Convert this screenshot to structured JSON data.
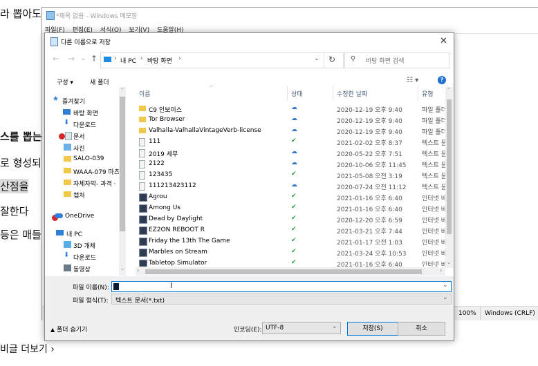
{
  "background_page": {
    "lines": [
      "라 뽑아도",
      "스를 뽑는",
      "로 형성되",
      "산점을",
      "잘한다",
      "등은 매들",
      "비글 더보기 ›"
    ]
  },
  "notepad": {
    "title": "*제목 없음 - Windows 메모장",
    "menu": [
      "파일(F)",
      "편집(E)",
      "서식(O)",
      "보기(V)",
      "도움말(H)"
    ],
    "status": {
      "zoom": "100%",
      "line_ending": "Windows (CRLF)"
    }
  },
  "dialog": {
    "title": "다른 이름으로 저장",
    "close": "✕",
    "breadcrumb": [
      "내 PC",
      "바탕 화면"
    ],
    "search_placeholder": "바탕 화면 검색",
    "cmd": {
      "organize": "구성 ▾",
      "new_folder": "새 폴더"
    },
    "tree": [
      {
        "label": "즐겨찾기",
        "icon": "star-icon",
        "pin": false
      },
      {
        "label": "바탕 화면",
        "icon": "desktop-icon",
        "pin": true
      },
      {
        "label": "다운로드",
        "icon": "download-icon",
        "pin": true
      },
      {
        "label": "문서",
        "icon": "document-icon",
        "pin": true
      },
      {
        "label": "사진",
        "icon": "pictures-icon",
        "pin": true
      },
      {
        "label": "SALO-039",
        "icon": "folder-icon",
        "pin": false
      },
      {
        "label": "WAAA-079 마츠",
        "icon": "folder-icon",
        "pin": false
      },
      {
        "label": "자체자막- 과격 ·",
        "icon": "folder-icon",
        "pin": false
      },
      {
        "label": "캡처",
        "icon": "folder-icon",
        "pin": false
      },
      {
        "label": "OneDrive",
        "icon": "cloud-icon",
        "pin": false
      },
      {
        "label": "내 PC",
        "icon": "pc-icon",
        "pin": false
      },
      {
        "label": "3D 개체",
        "icon": "cube-icon",
        "pin": false
      },
      {
        "label": "다운로드",
        "icon": "download-icon",
        "pin": false
      },
      {
        "label": "동영상",
        "icon": "video-icon",
        "pin": false
      }
    ],
    "columns": {
      "name": "이름",
      "status": "상태",
      "modified": "수정한 날짜",
      "type": "유형"
    },
    "files": [
      {
        "name": "C9 인보이스",
        "kind": "folder",
        "status": "cloud",
        "date": "2020-12-19 오후 9:40",
        "type": "파일 폴더"
      },
      {
        "name": "Tor Browser",
        "kind": "folder",
        "status": "cloud",
        "date": "2020-12-19 오후 9:40",
        "type": "파일 폴더"
      },
      {
        "name": "Valhalla-ValhallaVintageVerb-license",
        "kind": "folder",
        "status": "cloud",
        "date": "2020-12-19 오후 9:40",
        "type": "파일 폴더"
      },
      {
        "name": "111",
        "kind": "doc",
        "status": "check",
        "date": "2021-02-02 오후 8:37",
        "type": "텍스트 문서"
      },
      {
        "name": "2019 세무",
        "kind": "doc",
        "status": "cloud",
        "date": "2020-05-22 오후 7:51",
        "type": "텍스트 문서"
      },
      {
        "name": "2122",
        "kind": "doc",
        "status": "cloud",
        "date": "2020-10-06 오후 11:45",
        "type": "텍스트 문서"
      },
      {
        "name": "123435",
        "kind": "doc",
        "status": "check",
        "date": "2021-05-08 오전 3:19",
        "type": "텍스트 문서"
      },
      {
        "name": "111213423112",
        "kind": "doc",
        "status": "cloud",
        "date": "2020-07-24 오전 11:12",
        "type": "텍스트 문서"
      },
      {
        "name": "Agrou",
        "kind": "link",
        "status": "check",
        "date": "2021-01-16 오후 6:40",
        "type": "인터넷 바로 가기"
      },
      {
        "name": "Among Us",
        "kind": "link",
        "status": "check",
        "date": "2021-01-16 오후 6:40",
        "type": "인터넷 바로 가기"
      },
      {
        "name": "Dead by Daylight",
        "kind": "link",
        "status": "check",
        "date": "2020-12-20 오후 6:59",
        "type": "인터넷 바로 가기"
      },
      {
        "name": "EZ2ON REBOOT  R",
        "kind": "link",
        "status": "check",
        "date": "2021-03-21 오후 7:44",
        "type": "인터넷 바로 가기"
      },
      {
        "name": "Friday the 13th The Game",
        "kind": "link",
        "status": "check",
        "date": "2021-01-17 오전 1:03",
        "type": "인터넷 바로 가기"
      },
      {
        "name": "Marbles on Stream",
        "kind": "link",
        "status": "check",
        "date": "2021-03-24 오후 10:53",
        "type": "인터넷 바로 가기"
      },
      {
        "name": "Tabletop Simulator",
        "kind": "link",
        "status": "check",
        "date": "2021-01-16 오후 6:40",
        "type": "인터넷 바로 가기"
      }
    ],
    "filename_label": "파일 이름(N):",
    "filename_value": "",
    "filetype_label": "파일 형식(T):",
    "filetype_value": "텍스트 문서(*.txt)",
    "hide_folders": "폴더 숨기기",
    "encoding_label": "인코딩(E):",
    "encoding_value": "UTF-8",
    "save": "저장(S)",
    "cancel": "취소"
  },
  "colors": {
    "accent": "#0078d7",
    "cloud": "#3a79c8",
    "check": "#2a9d3e",
    "folder": "#f2c84b"
  }
}
